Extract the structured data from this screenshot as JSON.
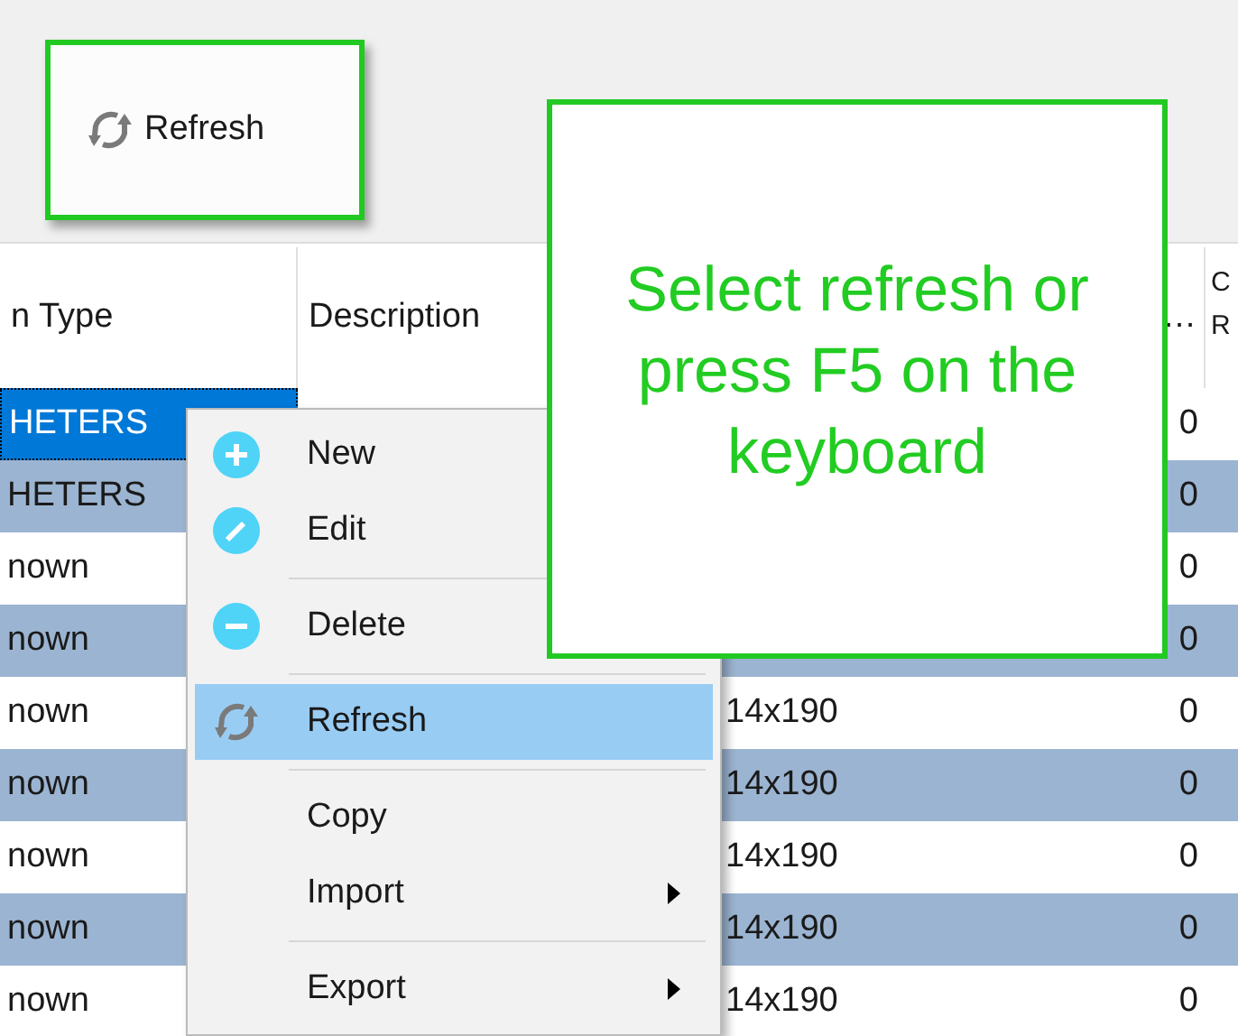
{
  "toolbar": {
    "buttons": [
      {
        "label": "Refresh"
      }
    ]
  },
  "table": {
    "columns": [
      "n Type",
      "Description",
      "",
      "…",
      "C R"
    ],
    "rows": [
      {
        "selected": true,
        "cells": [
          "HETERS",
          "",
          "",
          "0",
          ""
        ]
      },
      {
        "selected": false,
        "cells": [
          "HETERS",
          "",
          "",
          "0",
          ""
        ]
      },
      {
        "selected": false,
        "cells": [
          "nown",
          "",
          "",
          "0",
          ""
        ]
      },
      {
        "selected": false,
        "cells": [
          "nown",
          "",
          "",
          "0",
          ""
        ]
      },
      {
        "selected": false,
        "cells": [
          "nown",
          "",
          "14x190",
          "0",
          ""
        ]
      },
      {
        "selected": false,
        "cells": [
          "nown",
          "",
          "14x190",
          "0",
          ""
        ]
      },
      {
        "selected": false,
        "cells": [
          "nown",
          "",
          "14x190",
          "0",
          ""
        ]
      },
      {
        "selected": false,
        "cells": [
          "nown",
          "",
          "14x190",
          "0",
          ""
        ]
      },
      {
        "selected": false,
        "cells": [
          "nown",
          "",
          "14x190",
          "0",
          ""
        ]
      }
    ]
  },
  "context_menu": {
    "items": [
      {
        "kind": "add",
        "label": "New",
        "selected": false
      },
      {
        "kind": "edit",
        "label": "Edit",
        "selected": false
      },
      {
        "kind": "separator"
      },
      {
        "kind": "delete",
        "label": "Delete",
        "selected": false
      },
      {
        "kind": "separator"
      },
      {
        "kind": "refresh",
        "label": "Refresh",
        "selected": true,
        "submenu": false
      },
      {
        "kind": "separator"
      },
      {
        "kind": "plain",
        "label": "Copy",
        "selected": false,
        "submenu": false
      },
      {
        "kind": "plain",
        "label": "Import",
        "selected": false,
        "submenu": true
      },
      {
        "kind": "separator"
      },
      {
        "kind": "plain",
        "label": "Export",
        "selected": false,
        "submenu": true
      }
    ]
  },
  "callout": {
    "text": "Select refresh or press F5 on the keyboard"
  }
}
